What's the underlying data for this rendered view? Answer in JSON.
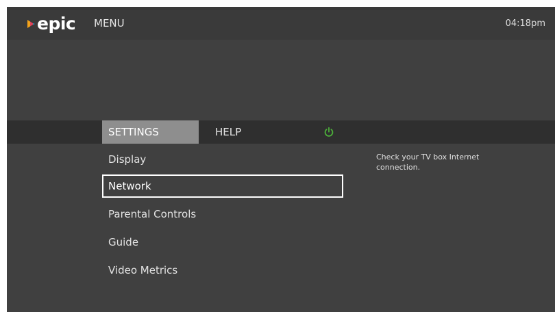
{
  "header": {
    "logo_text": "epic",
    "title": "MENU",
    "clock": "04:18pm"
  },
  "tabs": [
    {
      "label": "SETTINGS",
      "selected": true
    },
    {
      "label": "HELP",
      "selected": false
    }
  ],
  "power_icon": "power-icon",
  "settings_menu": {
    "items": [
      {
        "label": "Display"
      },
      {
        "label": "Network",
        "focused": true
      },
      {
        "label": "Parental Controls"
      },
      {
        "label": "Guide"
      },
      {
        "label": "Video Metrics"
      }
    ],
    "description": "Check your TV box Internet connection."
  },
  "colors": {
    "background": "#404040",
    "tab_bar": "#2f2f2f",
    "tab_selected": "#8e8e8e",
    "power_icon": "#4caf3a",
    "logo_accent_1": "#f2a21b",
    "logo_accent_2": "#e0455a",
    "logo_accent_3": "#2aa0d8"
  }
}
